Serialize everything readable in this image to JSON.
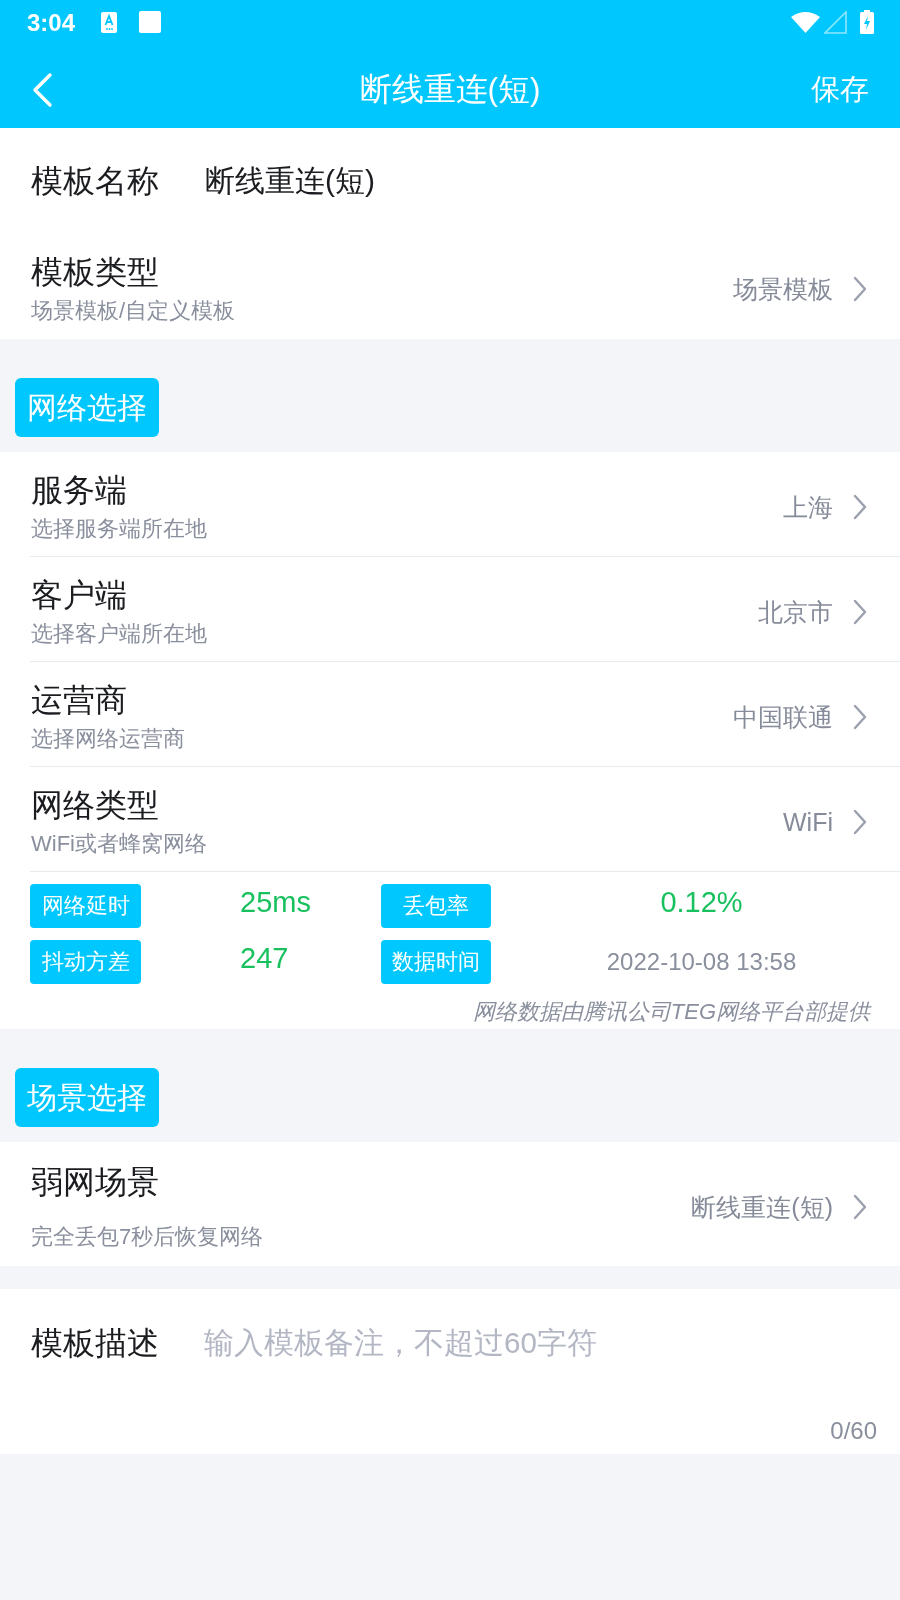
{
  "status_bar": {
    "time": "3:04"
  },
  "header": {
    "title": "断线重连(短)",
    "action": "保存"
  },
  "template_name": {
    "label": "模板名称",
    "value": "断线重连(短)"
  },
  "template_type": {
    "label": "模板类型",
    "hint": "场景模板/自定义模板",
    "value": "场景模板"
  },
  "network": {
    "tag": "网络选择",
    "rows": [
      {
        "label": "服务端",
        "hint": "选择服务端所在地",
        "value": "上海"
      },
      {
        "label": "客户端",
        "hint": "选择客户端所在地",
        "value": "北京市"
      },
      {
        "label": "运营商",
        "hint": "选择网络运营商",
        "value": "中国联通"
      },
      {
        "label": "网络类型",
        "hint": "WiFi或者蜂窝网络",
        "value": "WiFi"
      }
    ],
    "stats": [
      {
        "label": "网络延时",
        "value": "25ms",
        "kind": "metric"
      },
      {
        "label": "丢包率",
        "value": "0.12%",
        "kind": "metric"
      },
      {
        "label": "抖动方差",
        "value": "247",
        "kind": "metric"
      },
      {
        "label": "数据时间",
        "value": "2022-10-08 13:58",
        "kind": "timestamp"
      }
    ],
    "credit": "网络数据由腾讯公司TEG网络平台部提供"
  },
  "scene": {
    "tag": "场景选择",
    "rows": [
      {
        "label": "弱网场景",
        "hint": "完全丢包7秒后恢复网络",
        "value": "断线重连(短)"
      }
    ]
  },
  "description": {
    "label": "模板描述",
    "placeholder": "输入模板备注，不超过60字符",
    "counter": "0/60"
  }
}
